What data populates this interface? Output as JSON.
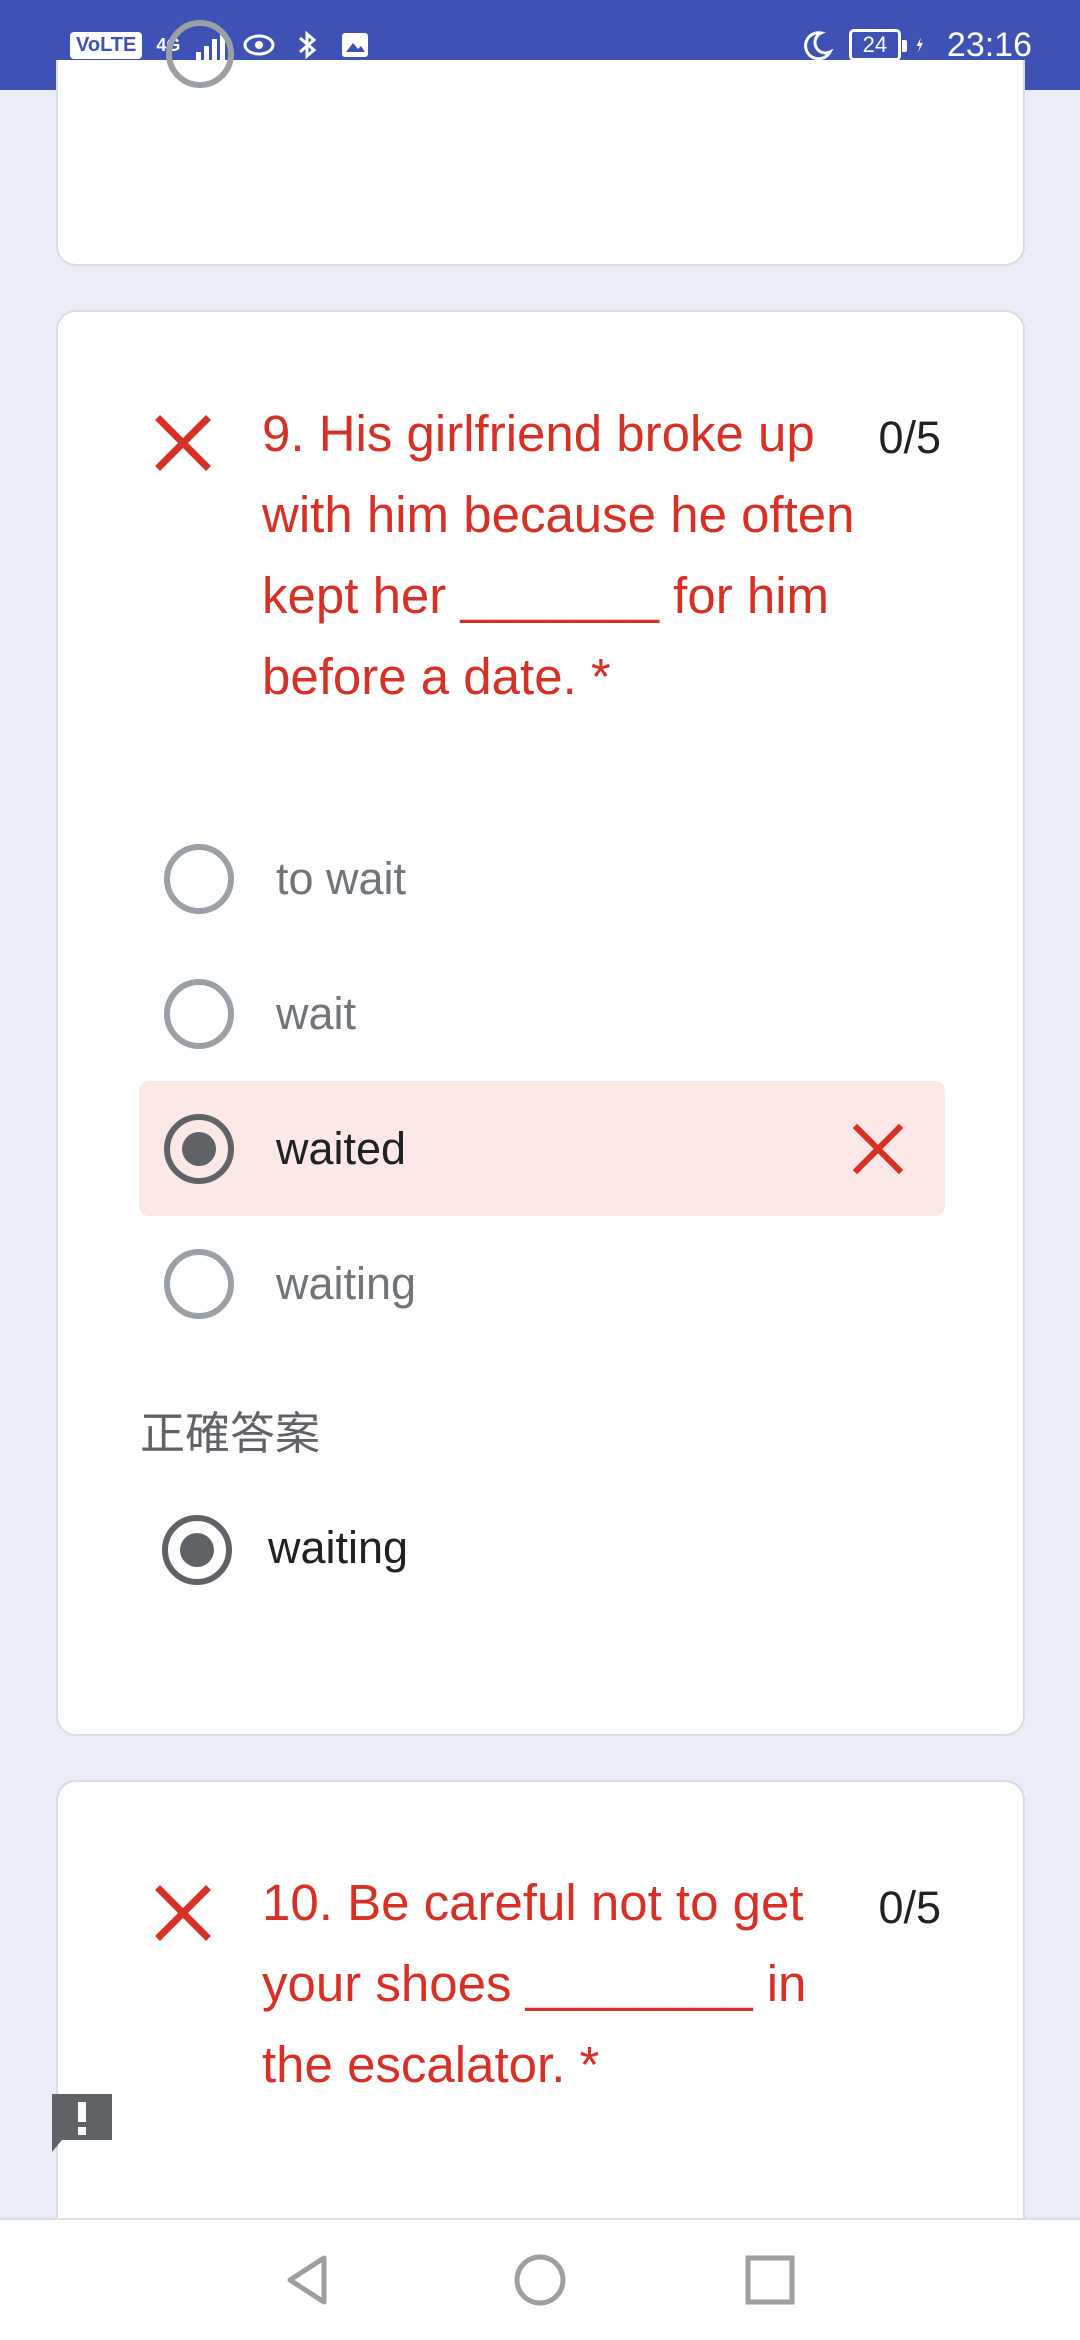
{
  "status_bar": {
    "network_badge": "VoLTE",
    "signal_label": "4G",
    "battery_level": "24",
    "time": "23:16"
  },
  "question9": {
    "text": "9. His girlfriend broke up with him because he often kept her _______ for him before a date. *",
    "score": "0/5",
    "options": [
      {
        "label": "to wait",
        "selected": false
      },
      {
        "label": "wait",
        "selected": false
      },
      {
        "label": "waited",
        "selected": true
      },
      {
        "label": "waiting",
        "selected": false
      }
    ],
    "correct_answer_heading": "正確答案",
    "correct_answer": "waiting"
  },
  "question10": {
    "text": "10. Be careful not to get your shoes ________ in the escalator. *",
    "score": "0/5"
  },
  "colors": {
    "status_bar": "#3e51b5",
    "background": "#eaedf7",
    "error_red": "#d93025",
    "wrong_highlight": "#fce8e6"
  },
  "icons": {
    "incorrect": "x-mark-icon",
    "feedback": "feedback-icon",
    "nav_back": "back-triangle-icon",
    "nav_home": "home-circle-icon",
    "nav_recents": "recents-square-icon"
  }
}
